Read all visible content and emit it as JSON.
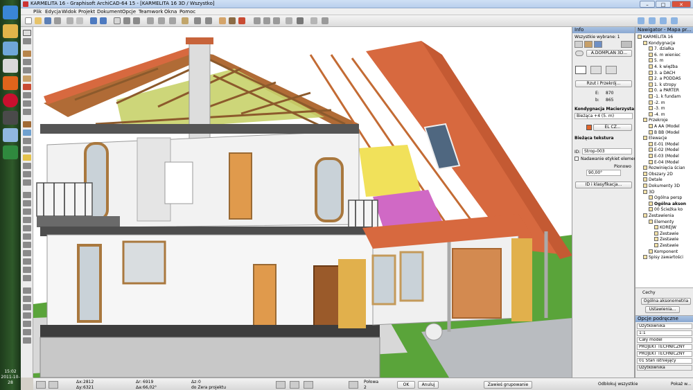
{
  "window": {
    "title": "KARMELITA 16 - Graphisoft ArchiCAD-64 15 - [KARMELITA 16 3D / Wszystko]",
    "minimize": "–",
    "maximize": "□",
    "close": "✕"
  },
  "menu": [
    "Plik",
    "Edycja",
    "Widok",
    "Projekt",
    "Dokument",
    "Opcje",
    "Teamwork",
    "Okna",
    "Pomoc"
  ],
  "taskbar": {
    "time": "15:02",
    "date": "2011-10-28"
  },
  "info": {
    "title": "Info",
    "selection": "Wszystkie wybrane: 1",
    "layer_button": "A.DOMPLAN 3D...",
    "plan_button": "Rzut i Przekrój...",
    "e_label": "E:",
    "e_value": "870",
    "b_label": "b:",
    "b_value": "865",
    "home_story_label": "Kondygnacja Macierzysta:",
    "home_story_value": "Bieżąca +4 (5. m)",
    "material_value": "EL CZ...",
    "texture_label": "Bieżąca tekstura",
    "id_label": "ID:",
    "id_value": "Strop-003",
    "label_check": "Nadawanie etykiet element.",
    "pionowo": "Pionowo",
    "angle": "90,00°",
    "class_button": "ID i klasyfikacja..."
  },
  "navigator": {
    "title": "Nawigator - Mapa pr...",
    "items": [
      {
        "label": "KARMELITA 16",
        "level": 0
      },
      {
        "label": "Kondygnacje",
        "level": 1
      },
      {
        "label": "7. działka",
        "level": 2
      },
      {
        "label": "6. m wieniec",
        "level": 2
      },
      {
        "label": "5. m",
        "level": 2
      },
      {
        "label": "4. k więźba",
        "level": 2
      },
      {
        "label": "3. a DACH",
        "level": 2
      },
      {
        "label": "2. a PODDAS",
        "level": 2
      },
      {
        "label": "1. k stropy",
        "level": 2
      },
      {
        "label": "0. a PARTER",
        "level": 2
      },
      {
        "label": "-1. k fundam",
        "level": 2
      },
      {
        "label": "-2. m",
        "level": 2
      },
      {
        "label": "-3. m",
        "level": 2
      },
      {
        "label": "-4. m",
        "level": 2
      },
      {
        "label": "Przekroje",
        "level": 1
      },
      {
        "label": "A AA (Model",
        "level": 2
      },
      {
        "label": "B BB (Model",
        "level": 2
      },
      {
        "label": "Elewacje",
        "level": 1
      },
      {
        "label": "E-01 (Model",
        "level": 2
      },
      {
        "label": "E-02 (Model",
        "level": 2
      },
      {
        "label": "E-03 (Model",
        "level": 2
      },
      {
        "label": "E-04 (Model",
        "level": 2
      },
      {
        "label": "Rozwinięcia ścian",
        "level": 1
      },
      {
        "label": "Obszary 2D",
        "level": 1
      },
      {
        "label": "Detale",
        "level": 1
      },
      {
        "label": "Dokumenty 3D",
        "level": 1
      },
      {
        "label": "3D",
        "level": 1
      },
      {
        "label": "Ogólna persp",
        "level": 2
      },
      {
        "label": "Ogólna akson",
        "level": 2
      },
      {
        "label": "00 Ścieżka ko",
        "level": 2
      },
      {
        "label": "Zestawienia",
        "level": 1
      },
      {
        "label": "Elementy",
        "level": 2
      },
      {
        "label": "KOREJW",
        "level": 3
      },
      {
        "label": "Zestawie",
        "level": 3
      },
      {
        "label": "Zestawie",
        "level": 3
      },
      {
        "label": "Zestawie",
        "level": 3
      },
      {
        "label": "Komponent",
        "level": 2
      },
      {
        "label": "Spisy zawartości",
        "level": 1
      }
    ],
    "cechy": "Cechy",
    "view_name": "Ogólna aksonometria",
    "settings_button": "Ustawienia..."
  },
  "opcje": {
    "title": "Opcje podręczne",
    "rows": [
      "Użytkownika",
      "1:1",
      "Cały model",
      "PROJEKT TECHNICZNY",
      "PROJEKT TECHNICZNY",
      "01 Stan istniejący",
      "Użytkownika"
    ]
  },
  "status": {
    "dx_label": "Δx:",
    "dx_value": "2812",
    "dy_label": "Δy:",
    "dy_value": "6321",
    "dr_label": "Δr:",
    "dr_value": "6919",
    "da_label": "Δa:",
    "da_value": "66,02°",
    "dz_label": "Δz:",
    "dz_value": "0",
    "ref_value": "do Zera projektu",
    "scale_label": "Połowa",
    "scale_value": "2",
    "ok": "OK",
    "cancel": "Anuluj",
    "group_button": "Zawieś grupowanie",
    "unlock": "Odblokuj wszystkie",
    "show_all": "Pokaż w..."
  }
}
